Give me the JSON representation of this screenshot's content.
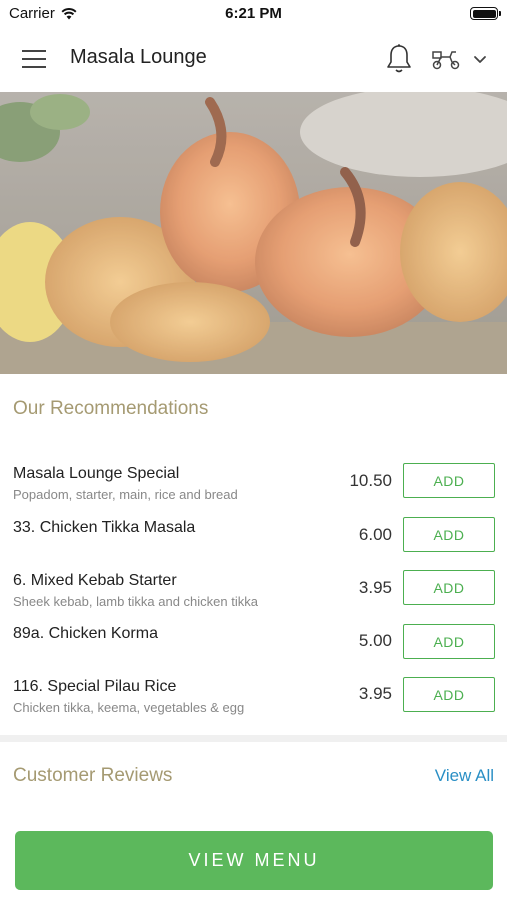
{
  "status_bar": {
    "carrier": "Carrier",
    "time": "6:21 PM"
  },
  "header": {
    "title": "Masala Lounge"
  },
  "icons": {
    "menu": "hamburger-menu-icon",
    "bell": "bell-icon",
    "scooter": "delivery-scooter-icon",
    "chevron": "chevron-down-icon",
    "wifi": "wifi-icon",
    "battery": "battery-icon"
  },
  "recommendations": {
    "title": "Our Recommendations",
    "add_label": "ADD",
    "items": [
      {
        "name": "Masala Lounge Special",
        "desc": "Popadom, starter, main, rice and bread",
        "price": "10.50"
      },
      {
        "name": "33. Chicken Tikka Masala",
        "desc": "",
        "price": "6.00"
      },
      {
        "name": "6. Mixed Kebab Starter",
        "desc": "Sheek kebab, lamb tikka and chicken tikka",
        "price": "3.95"
      },
      {
        "name": "89a. Chicken Korma",
        "desc": "",
        "price": "5.00"
      },
      {
        "name": "116. Special Pilau Rice",
        "desc": "Chicken tikka, keema, vegetables & egg",
        "price": "3.95"
      }
    ]
  },
  "reviews": {
    "title": "Customer Reviews",
    "view_all": "View All"
  },
  "cta": {
    "view_menu": "VIEW MENU"
  },
  "colors": {
    "accent_green": "#5cb85c",
    "section_title": "#a59a72",
    "link_blue": "#2a8fc5"
  }
}
